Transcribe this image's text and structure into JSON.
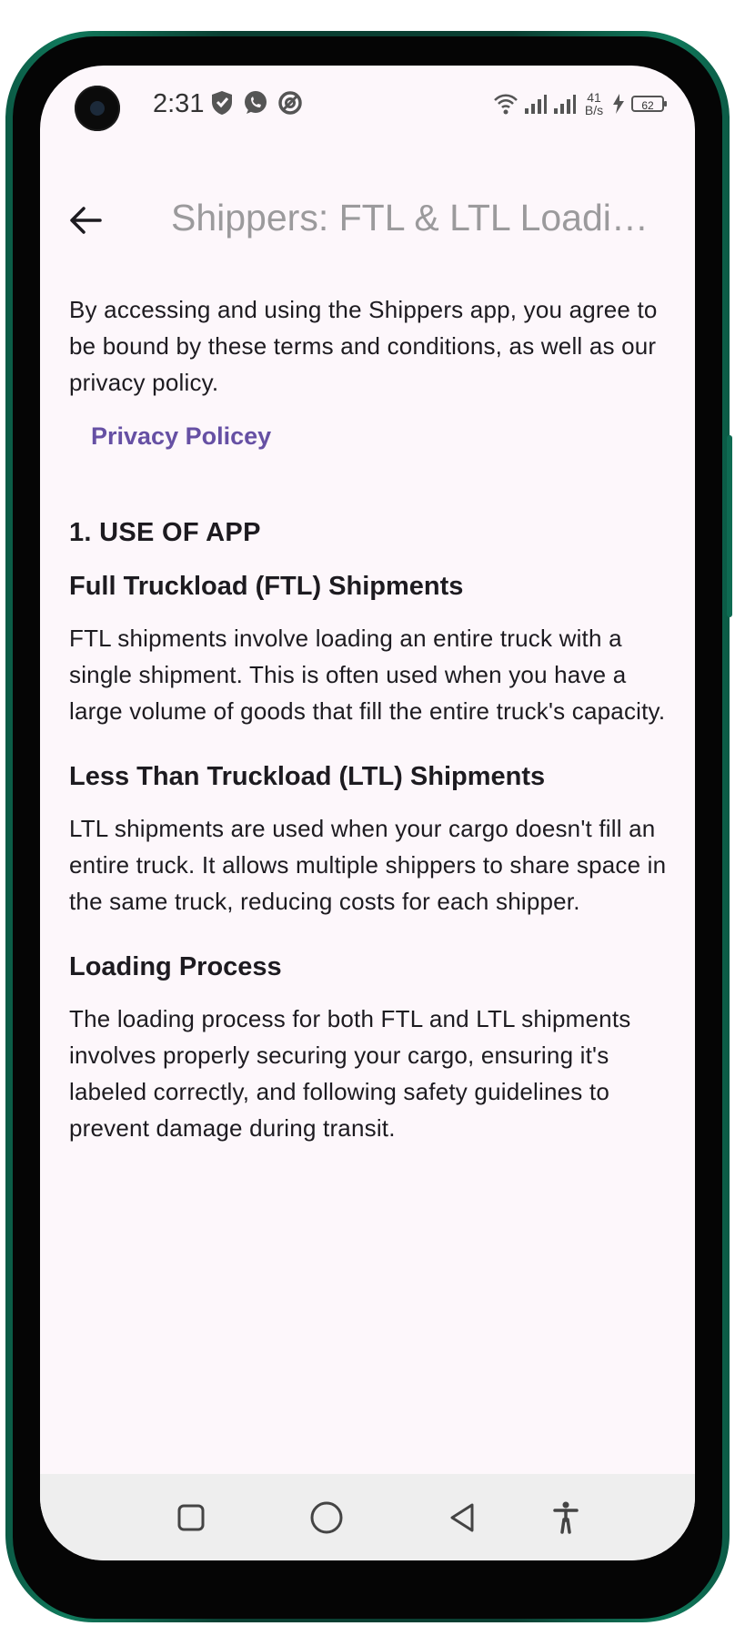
{
  "status_bar": {
    "time": "2:31",
    "net_speed_value": "41",
    "net_speed_unit": "B/s",
    "battery_level": "62",
    "left_icons": [
      "shield-icon",
      "whatsapp-icon",
      "at-sign-icon"
    ],
    "right_icons": [
      "wifi-icon",
      "signal-icon",
      "signal-icon",
      "charging-icon",
      "battery-icon"
    ]
  },
  "app_bar": {
    "title": "Shippers: FTL & LTL Loadi…",
    "back_icon": "arrow-back-icon"
  },
  "content": {
    "intro": "By accessing and using the Shippers app, you agree to be bound by these terms and conditions, as well as our privacy policy.",
    "privacy_link": "Privacy Policey",
    "section_title": "1. USE OF APP",
    "sections": [
      {
        "heading": "Full Truckload (FTL) Shipments",
        "body": "FTL shipments involve loading an entire truck with a single shipment. This is often used when you have a large volume of goods that fill the entire truck's capacity."
      },
      {
        "heading": "Less Than Truckload (LTL) Shipments",
        "body": "LTL shipments are used when your cargo doesn't fill an entire truck. It allows multiple shippers to share space in the same truck, reducing costs for each shipper."
      },
      {
        "heading": "Loading Process",
        "body": "The loading process for both FTL and LTL shipments involves properly securing your cargo, ensuring it's labeled correctly, and following safety guidelines to prevent damage during transit."
      }
    ]
  },
  "nav_bar": {
    "buttons": [
      "recents-square-icon",
      "home-circle-icon",
      "back-triangle-icon",
      "accessibility-icon"
    ]
  },
  "colors": {
    "background": "#fdf7fb",
    "link": "#6650a4",
    "title_gray": "#9b9a9c",
    "text": "#1d1b20",
    "frame_green": "#0b5a45",
    "nav_bar_bg": "#eeeeee"
  }
}
